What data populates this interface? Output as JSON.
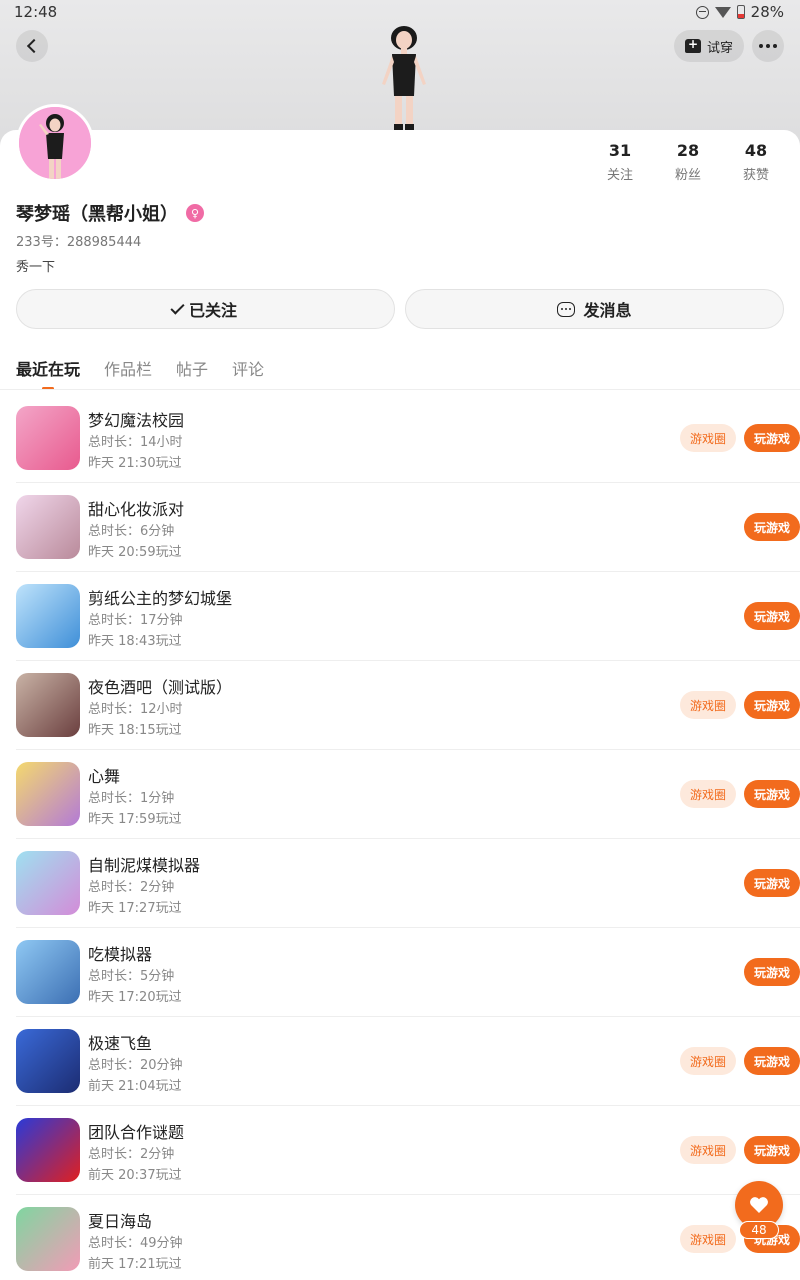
{
  "status_bar": {
    "time": "12:48",
    "battery": "28%"
  },
  "header": {
    "tryon_label": "试穿"
  },
  "profile": {
    "stats": [
      {
        "count": "31",
        "label": "关注"
      },
      {
        "count": "28",
        "label": "粉丝"
      },
      {
        "count": "48",
        "label": "获赞"
      }
    ],
    "username": "琴梦瑶（黑帮小姐）",
    "user_id": "233号：288985444",
    "bio": "秀一下",
    "follow_label": "已关注",
    "message_label": "发消息"
  },
  "tabs": [
    "最近在玩",
    "作品栏",
    "帖子",
    "评论"
  ],
  "buttons": {
    "circle": "游戏圈",
    "play": "玩游戏"
  },
  "games": [
    {
      "name": "梦幻魔法校园",
      "duration": "总时长：14小时",
      "last_played": "昨天 21:30玩过",
      "has_circle": true,
      "colors": [
        "#f3a6c8",
        "#e85a8e"
      ]
    },
    {
      "name": "甜心化妆派对",
      "duration": "总时长：6分钟",
      "last_played": "昨天 20:59玩过",
      "has_circle": false,
      "colors": [
        "#f0d6ea",
        "#b98a9a"
      ]
    },
    {
      "name": "剪纸公主的梦幻城堡",
      "duration": "总时长：17分钟",
      "last_played": "昨天 18:43玩过",
      "has_circle": false,
      "colors": [
        "#bfe3fb",
        "#3f8fd8"
      ]
    },
    {
      "name": "夜色酒吧（测试版）",
      "duration": "总时长：12小时",
      "last_played": "昨天 18:15玩过",
      "has_circle": true,
      "colors": [
        "#c9b3a6",
        "#6b3f3f"
      ]
    },
    {
      "name": "心舞",
      "duration": "总时长：1分钟",
      "last_played": "昨天 17:59玩过",
      "has_circle": true,
      "colors": [
        "#f4d96e",
        "#b37ad6"
      ]
    },
    {
      "name": "自制泥煤模拟器",
      "duration": "总时长：2分钟",
      "last_played": "昨天 17:27玩过",
      "has_circle": false,
      "colors": [
        "#9fe0f0",
        "#d38cd8"
      ]
    },
    {
      "name": "吃模拟器",
      "duration": "总时长：5分钟",
      "last_played": "昨天 17:20玩过",
      "has_circle": false,
      "colors": [
        "#8fc8f3",
        "#3c6fb3"
      ]
    },
    {
      "name": "极速飞鱼",
      "duration": "总时长：20分钟",
      "last_played": "前天 21:04玩过",
      "has_circle": true,
      "colors": [
        "#3a6ad8",
        "#1c2c72"
      ]
    },
    {
      "name": "团队合作谜题",
      "duration": "总时长：2分钟",
      "last_played": "前天 20:37玩过",
      "has_circle": true,
      "colors": [
        "#2a3ad8",
        "#e02020"
      ]
    },
    {
      "name": "夏日海岛",
      "duration": "总时长：49分钟",
      "last_played": "前天 17:21玩过",
      "has_circle": true,
      "colors": [
        "#7fd6a0",
        "#f29bb6"
      ]
    }
  ],
  "like_count": "48",
  "colors": {
    "accent": "#f26b1d",
    "accent_light": "#fde9dc"
  }
}
